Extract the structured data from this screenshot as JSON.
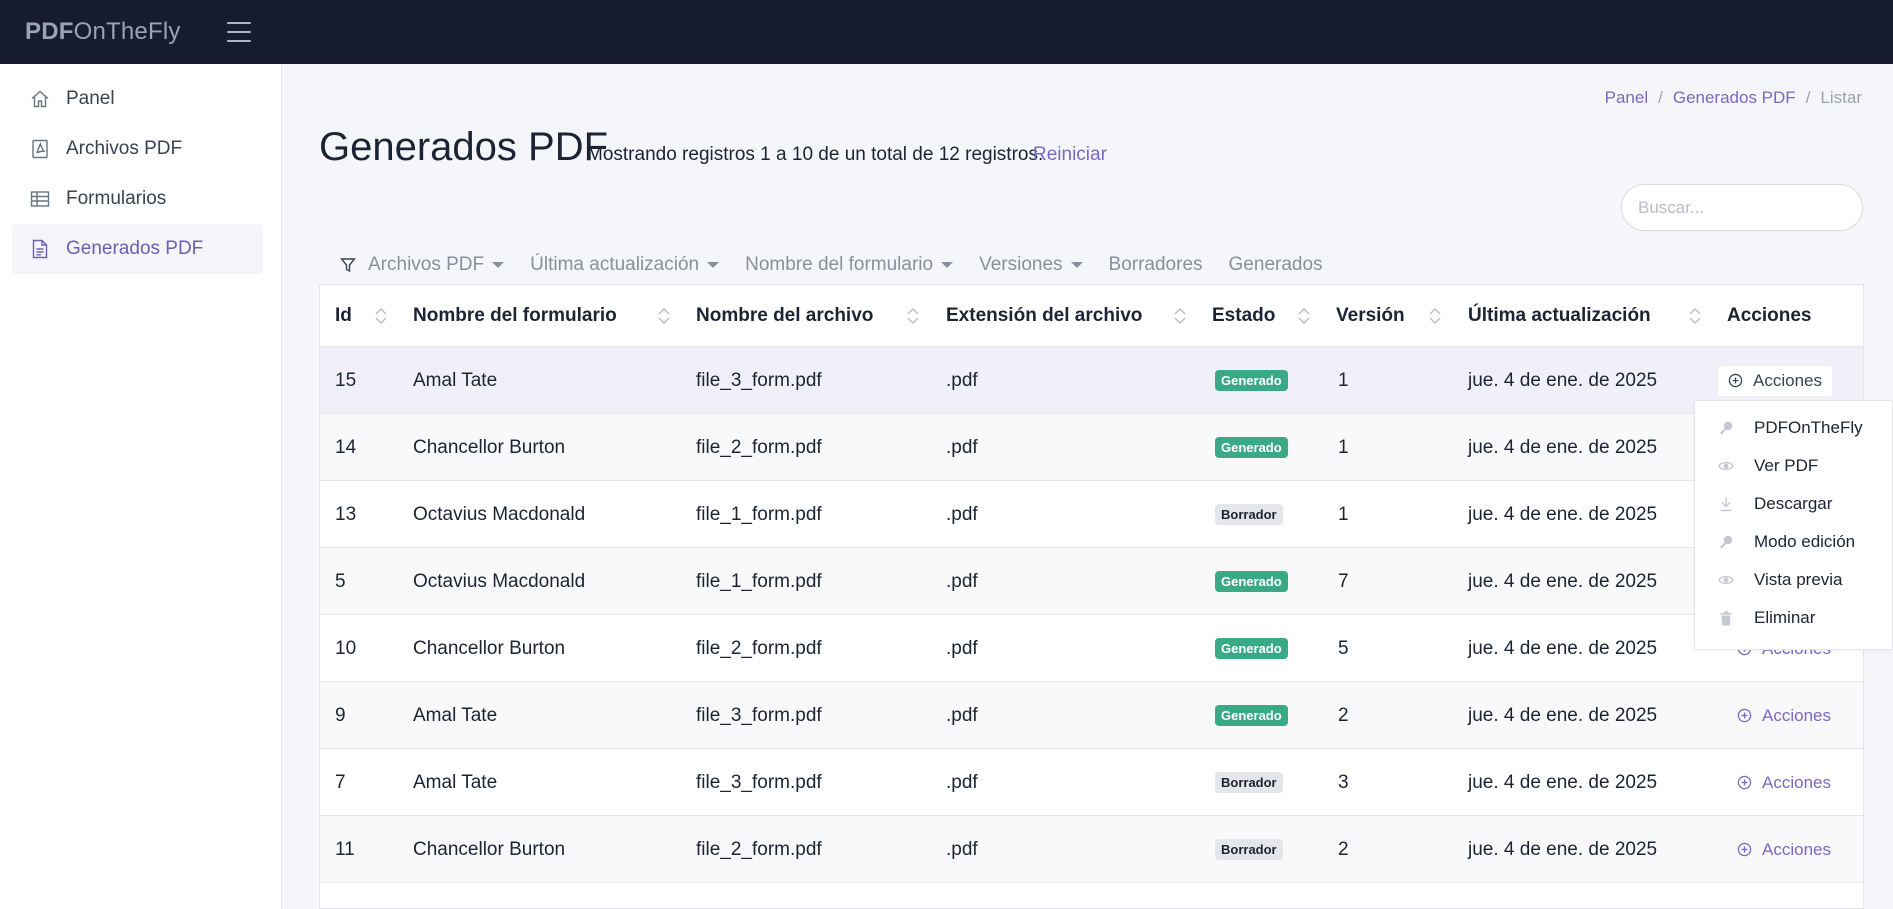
{
  "app": {
    "brand_bold": "PDF",
    "brand_rest": "OnTheFly"
  },
  "sidebar": {
    "items": [
      {
        "label": "Panel",
        "icon": "home-icon"
      },
      {
        "label": "Archivos PDF",
        "icon": "pdf-file-icon"
      },
      {
        "label": "Formularios",
        "icon": "table-icon"
      },
      {
        "label": "Generados PDF",
        "icon": "document-icon",
        "active": true
      }
    ]
  },
  "breadcrumb": {
    "item1": "Panel",
    "sep": "/",
    "item2": "Generados PDF",
    "item3": "Listar"
  },
  "page": {
    "title": "Generados PDF",
    "subtitle": "Mostrando registros 1 a 10 de un total de 12 registros.",
    "reset": "Reiniciar"
  },
  "search": {
    "placeholder": "Buscar...",
    "value": ""
  },
  "filters": {
    "archivos": "Archivos PDF",
    "actualizacion": "Última actualización",
    "formulario": "Nombre del formulario",
    "versiones": "Versiones",
    "borradores": "Borradores",
    "generados": "Generados"
  },
  "table": {
    "headers": {
      "id": "Id",
      "form": "Nombre del formulario",
      "file": "Nombre del archivo",
      "ext": "Extensión del archivo",
      "status": "Estado",
      "version": "Versión",
      "updated": "Última actualización",
      "actions": "Acciones"
    },
    "action_label": "Acciones",
    "rows": [
      {
        "id": "15",
        "form": "Amal Tate",
        "file": "file_3_form.pdf",
        "ext": ".pdf",
        "status": "Generado",
        "version": "1",
        "updated": "jue. 4 de ene. de 2025"
      },
      {
        "id": "14",
        "form": "Chancellor Burton",
        "file": "file_2_form.pdf",
        "ext": ".pdf",
        "status": "Generado",
        "version": "1",
        "updated": "jue. 4 de ene. de 2025"
      },
      {
        "id": "13",
        "form": "Octavius Macdonald",
        "file": "file_1_form.pdf",
        "ext": ".pdf",
        "status": "Borrador",
        "version": "1",
        "updated": "jue. 4 de ene. de 2025"
      },
      {
        "id": "5",
        "form": "Octavius Macdonald",
        "file": "file_1_form.pdf",
        "ext": ".pdf",
        "status": "Generado",
        "version": "7",
        "updated": "jue. 4 de ene. de 2025"
      },
      {
        "id": "10",
        "form": "Chancellor Burton",
        "file": "file_2_form.pdf",
        "ext": ".pdf",
        "status": "Generado",
        "version": "5",
        "updated": "jue. 4 de ene. de 2025"
      },
      {
        "id": "9",
        "form": "Amal Tate",
        "file": "file_3_form.pdf",
        "ext": ".pdf",
        "status": "Generado",
        "version": "2",
        "updated": "jue. 4 de ene. de 2025"
      },
      {
        "id": "7",
        "form": "Amal Tate",
        "file": "file_3_form.pdf",
        "ext": ".pdf",
        "status": "Borrador",
        "version": "3",
        "updated": "jue. 4 de ene. de 2025"
      },
      {
        "id": "11",
        "form": "Chancellor Burton",
        "file": "file_2_form.pdf",
        "ext": ".pdf",
        "status": "Borrador",
        "version": "2",
        "updated": "jue. 4 de ene. de 2025"
      }
    ]
  },
  "dropdown": {
    "items": [
      {
        "label": "PDFOnTheFly",
        "icon": "wrench-icon"
      },
      {
        "label": "Ver PDF",
        "icon": "eye-icon"
      },
      {
        "label": "Descargar",
        "icon": "download-icon"
      },
      {
        "label": "Modo edición",
        "icon": "wrench-icon"
      },
      {
        "label": "Vista previa",
        "icon": "eye-icon"
      },
      {
        "label": "Eliminar",
        "icon": "trash-icon"
      }
    ]
  },
  "colors": {
    "accent": "#7b68c4",
    "topbar": "#161c2d",
    "generado": "#3aaa86",
    "borrador": "#e4e6eb"
  }
}
